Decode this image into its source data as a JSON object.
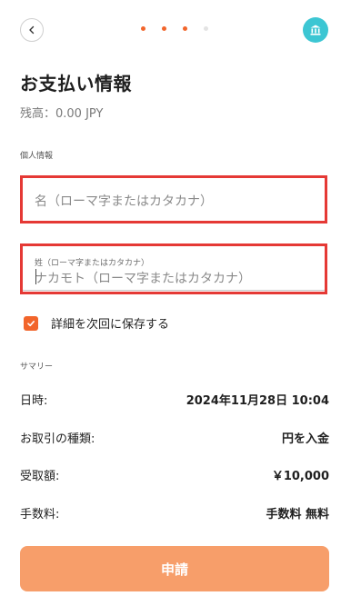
{
  "header": {
    "back_icon": "chevron-left-icon",
    "steps": [
      {
        "state": "done"
      },
      {
        "state": "done"
      },
      {
        "state": "done"
      },
      {
        "state": "inactive"
      }
    ],
    "bank_icon": "bank-icon",
    "colors": {
      "accent": "#f2652b",
      "bank": "#3cc6d3"
    }
  },
  "page": {
    "title": "お支払い情報",
    "balance": "残高：0.00 JPY"
  },
  "personal": {
    "section_label": "個人情報",
    "first_name": {
      "placeholder": "名（ローマ字またはカタカナ）"
    },
    "last_name": {
      "label": "姓（ローマ字またはカタカナ）",
      "value": "ナカモト（ローマ字またはカタカナ）"
    },
    "save_details": {
      "label": "詳細を次回に保存する",
      "checked": true
    }
  },
  "summary": {
    "section_label": "サマリー",
    "rows": [
      {
        "label": "日時:",
        "value": "2024年11月28日 10:04"
      },
      {
        "label": "お取引の種類:",
        "value": "円を入金"
      },
      {
        "label": "受取額:",
        "value": "￥10,000"
      },
      {
        "label": "手数料:",
        "value": "手数料 無料"
      }
    ]
  },
  "submit": {
    "label": "申請",
    "color": "#f79e6a"
  }
}
